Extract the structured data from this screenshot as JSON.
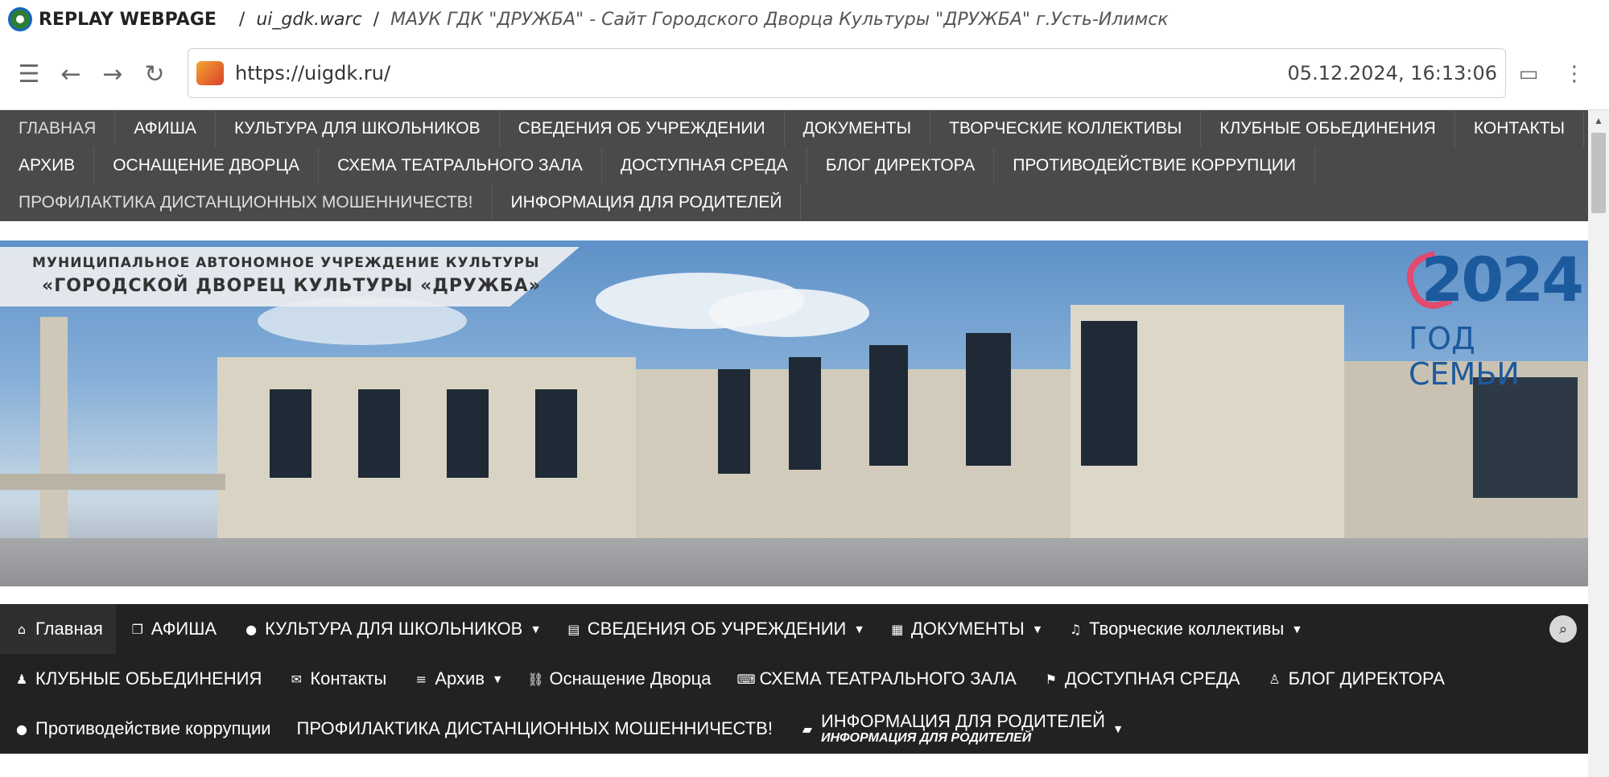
{
  "replay": {
    "brand": "REPLAY WEBPAGE",
    "separator": "/",
    "file": "ui_gdk.warc",
    "page_title": "МАУК ГДК \"ДРУЖБА\" - Сайт Городского Дворца Культуры \"ДРУЖБА\" г.Усть-Илимск"
  },
  "addressbar": {
    "url": "https://uigdk.ru/",
    "timestamp": "05.12.2024, 16:13:06"
  },
  "top_menu": {
    "rows": [
      [
        "ГЛАВНАЯ",
        "АФИША",
        "КУЛЬТУРА ДЛЯ ШКОЛЬНИКОВ",
        "СВЕДЕНИЯ ОБ УЧРЕЖДЕНИИ",
        "ДОКУМЕНТЫ",
        "ТВОРЧЕСКИЕ КОЛЛЕКТИВЫ",
        "КЛУБНЫЕ ОБЬЕДИНЕНИЯ",
        "КОНТАКТЫ"
      ],
      [
        "АРХИВ",
        "ОСНАЩЕНИЕ ДВОРЦА",
        "СХЕМА ТЕАТРАЛЬНОГО ЗАЛА",
        "ДОСТУПНАЯ СРЕДА",
        "БЛОГ ДИРЕКТОРА",
        "ПРОТИВОДЕЙСТВИЕ КОРРУПЦИИ"
      ],
      [
        "ПРОФИЛАКТИКА ДИСТАНЦИОННЫХ МОШЕННИЧЕСТВ!",
        "ИНФОРМАЦИЯ ДЛЯ РОДИТЕЛЕЙ"
      ]
    ]
  },
  "banner": {
    "caption_line1": "МУНИЦИПАЛЬНОЕ АВТОНОМНОЕ УЧРЕЖДЕНИЕ КУЛЬТУРЫ",
    "caption_line2": "«ГОРОДСКОЙ ДВОРЕЦ КУЛЬТУРЫ «ДРУЖБА»",
    "year": "2024",
    "year_text": "ГОД СЕМЬИ"
  },
  "main_menu": {
    "row1": [
      {
        "icon": "home-icon",
        "label": "Главная",
        "caret": false
      },
      {
        "icon": "copy-icon",
        "label": "АФИША",
        "caret": false
      },
      {
        "icon": "lightbulb-icon",
        "label": "КУЛЬТУРА ДЛЯ ШКОЛЬНИКОВ",
        "caret": true
      },
      {
        "icon": "document-icon",
        "label": "СВЕДЕНИЯ ОБ УЧРЕЖДЕНИИ",
        "caret": true
      },
      {
        "icon": "list-icon",
        "label": "ДОКУМЕНТЫ",
        "caret": true
      },
      {
        "icon": "music-icon",
        "label": "Творческие коллективы",
        "caret": true
      }
    ],
    "row2": [
      {
        "icon": "user-icon",
        "label": "КЛУБНЫЕ ОБЬЕДИНЕНИЯ",
        "caret": false
      },
      {
        "icon": "envelope-icon",
        "label": "Контакты",
        "caret": false
      },
      {
        "icon": "menu-icon",
        "label": "Архив",
        "caret": true
      },
      {
        "icon": "link-icon",
        "label": "Оснащение Дворца",
        "caret": false
      },
      {
        "icon": "keyboard-icon",
        "label": "СХЕМА ТЕАТРАЛЬНОГО ЗАЛА",
        "caret": false
      },
      {
        "icon": "flag-icon",
        "label": "ДОСТУПНАЯ СРЕДА",
        "caret": false
      },
      {
        "icon": "user-tie-icon",
        "label": "БЛОГ ДИРЕКТОРА",
        "caret": false
      }
    ],
    "row3": [
      {
        "icon": "lightbulb-icon",
        "label": "Противодействие коррупции",
        "caret": false
      },
      {
        "icon": "",
        "label": "ПРОФИЛАКТИКА ДИСТАНЦИОННЫХ МОШЕННИЧЕСТВ!",
        "caret": false
      },
      {
        "icon": "comment-icon",
        "label": "ИНФОРМАЦИЯ ДЛЯ РОДИТЕЛЕЙ",
        "sub": "ИНФОРМАЦИЯ ДЛЯ РОДИТЕЛЕЙ",
        "caret": true
      }
    ],
    "search_icon": "search-icon"
  }
}
